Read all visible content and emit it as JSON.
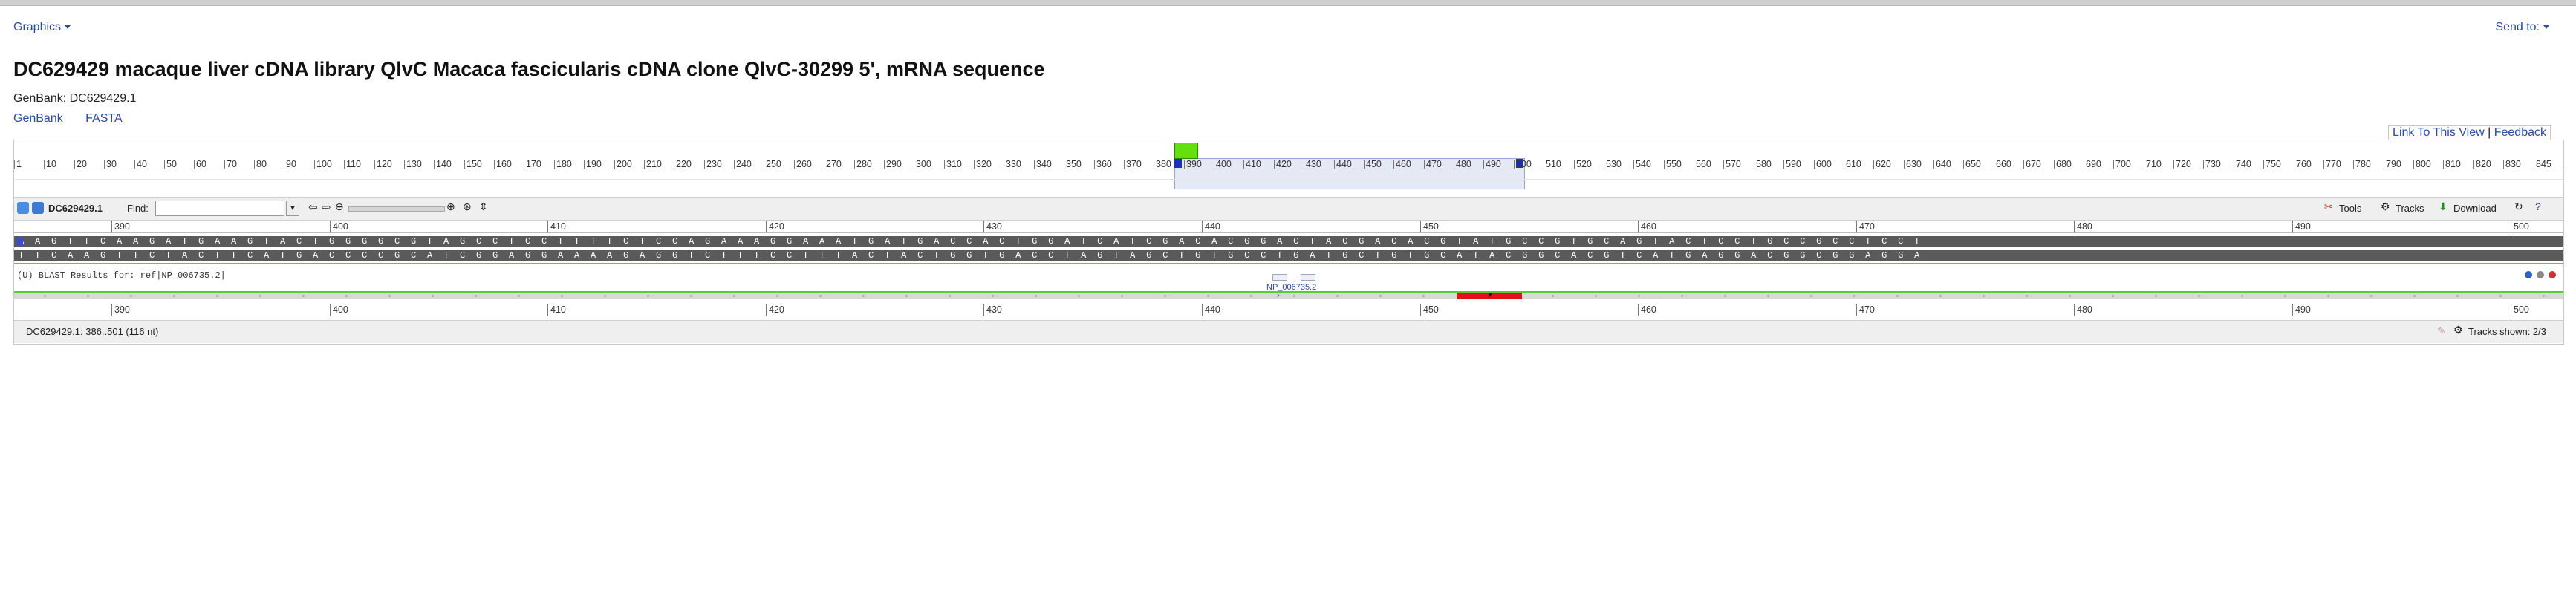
{
  "header": {
    "graphics_label": "Graphics",
    "send_to_label": "Send to:",
    "title": "DC629429 macaque liver cDNA library QlvC Macaca fascicularis cDNA clone QlvC-30299 5', mRNA sequence",
    "accession": "GenBank: DC629429.1",
    "links": [
      "GenBank",
      "FASTA"
    ],
    "link_to_view": "Link To This View",
    "separator": "|",
    "feedback": "Feedback"
  },
  "overview": {
    "labels": [
      "1",
      "10",
      "20",
      "30",
      "40",
      "50",
      "60",
      "70",
      "80",
      "90",
      "100",
      "110",
      "120",
      "130",
      "140",
      "150",
      "160",
      "170",
      "180",
      "190",
      "200",
      "210",
      "220",
      "230",
      "240",
      "250",
      "260",
      "270",
      "280",
      "290",
      "300",
      "310",
      "320",
      "330",
      "340",
      "350",
      "360",
      "370",
      "380",
      "390",
      "400",
      "410",
      "420",
      "430",
      "440",
      "450",
      "460",
      "470",
      "480",
      "490",
      "500",
      "510",
      "520",
      "530",
      "540",
      "550",
      "560",
      "570",
      "580",
      "590",
      "600",
      "610",
      "620",
      "630",
      "640",
      "650",
      "660",
      "670",
      "680",
      "690",
      "700",
      "710",
      "720",
      "730",
      "740",
      "750",
      "760",
      "770",
      "780",
      "790",
      "800",
      "810",
      "820",
      "830",
      "845"
    ]
  },
  "toolbar": {
    "seq_id": "DC629429.1",
    "find_label": "Find:",
    "find_value": "",
    "tools_label": "Tools",
    "tracks_label": "Tracks",
    "download_label": "Download"
  },
  "ruler": {
    "labels": [
      "390",
      "400",
      "410",
      "420",
      "430",
      "440",
      "450",
      "460",
      "470",
      "480",
      "490",
      "500"
    ]
  },
  "sequence": {
    "forward": "AAGTTCAAGATGAAGTACTGGGGCGTAGCCTCCTTTTCTCCAGAAAGGAAATGATGACCACTGGATCATCGACACGGACTACGACACGTATGCCGTGCAGTACTCCTGCCGCCTCCT",
    "reverse": "TTCAAGTTCTACTTCATGACCCCGCATCGGAGGAAAAGAGGTCTTTCCTTTACTACTGGTGACCTAGTAGCTGTGCCTGATGCTGTGCATACGGCACGTCATGAGGACGGCGGAGGA"
  },
  "track": {
    "title": "(U) BLAST Results for: ref|NP_006735.2|",
    "feature_label": "NP_006735.2"
  },
  "status": {
    "range_text": "DC629429.1: 386..501 (116 nt)",
    "tracks_shown": "Tracks shown: 2/3"
  },
  "colors": {
    "accent": "#2a4ba8",
    "selection_green": "#62e012",
    "blast_hit": "#e3101a",
    "sequence_bg": "#5a5a5a"
  }
}
